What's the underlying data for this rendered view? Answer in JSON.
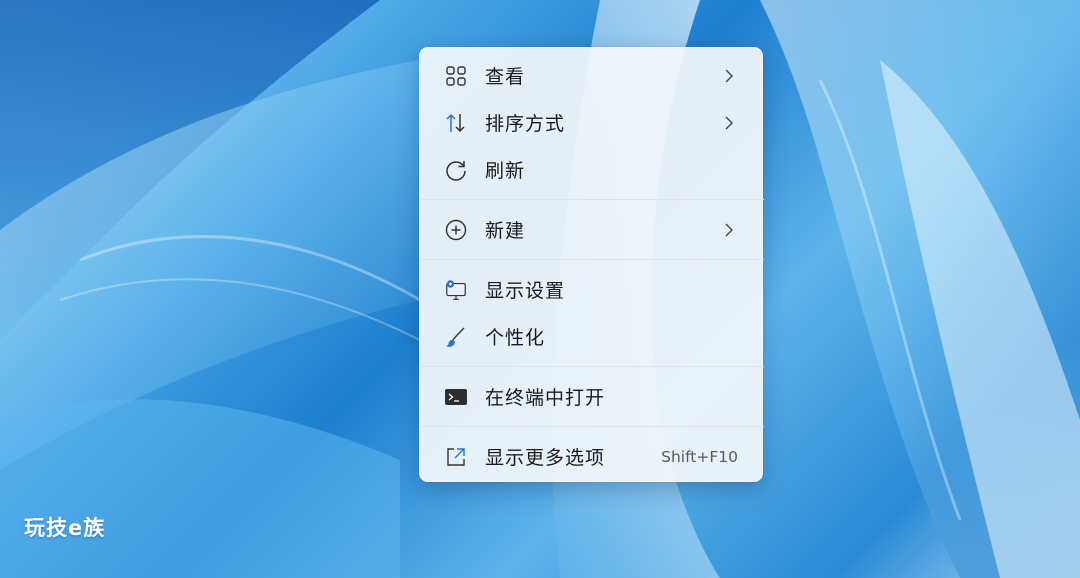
{
  "context_menu": {
    "items": [
      {
        "label": "查看",
        "icon": "grid-view-icon",
        "submenu": true
      },
      {
        "label": "排序方式",
        "icon": "sort-arrows-icon",
        "submenu": true
      },
      {
        "label": "刷新",
        "icon": "refresh-icon",
        "submenu": false
      },
      {
        "label": "新建",
        "icon": "plus-circle-icon",
        "submenu": true
      },
      {
        "label": "显示设置",
        "icon": "display-settings-icon",
        "submenu": false
      },
      {
        "label": "个性化",
        "icon": "paintbrush-icon",
        "submenu": false
      },
      {
        "label": "在终端中打开",
        "icon": "terminal-icon",
        "submenu": false
      },
      {
        "label": "显示更多选项",
        "icon": "show-more-icon",
        "submenu": false,
        "shortcut": "Shift+F10"
      }
    ]
  },
  "watermark": {
    "text": "玩技e族"
  },
  "colors": {
    "accent": "#2b73c9",
    "menu_bg": "#f3f6fa",
    "text": "#1b1b1b"
  }
}
